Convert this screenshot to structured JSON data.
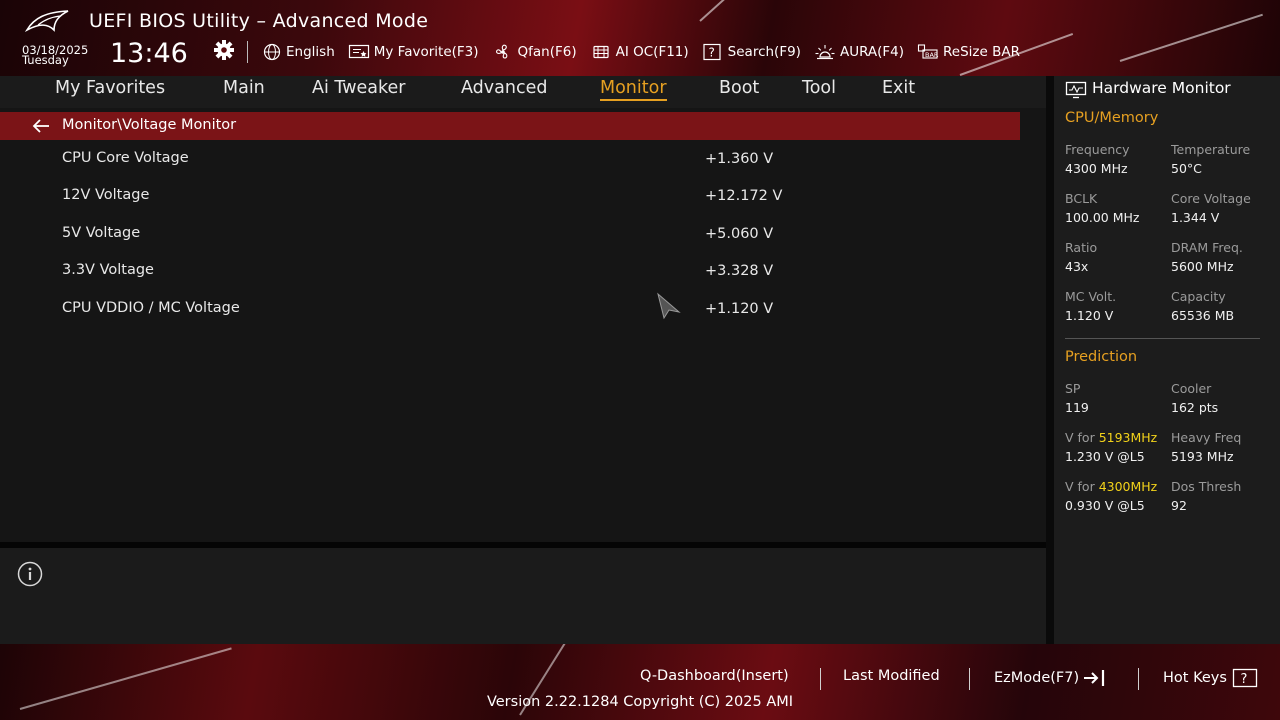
{
  "header": {
    "title": "UEFI BIOS Utility – Advanced Mode",
    "date": "03/18/2025",
    "day": "Tuesday",
    "time": "13:46"
  },
  "toolbar": {
    "items": [
      {
        "label": "English",
        "icon": "globe-icon"
      },
      {
        "label": "My Favorite(F3)",
        "icon": "favorite-monitor-icon"
      },
      {
        "label": "Qfan(F6)",
        "icon": "fan-icon"
      },
      {
        "label": "AI OC(F11)",
        "icon": "ai-chip-icon"
      },
      {
        "label": "Search(F9)",
        "icon": "search-help-icon"
      },
      {
        "label": "AURA(F4)",
        "icon": "aura-light-icon"
      },
      {
        "label": "ReSize BAR",
        "icon": "resize-bar-icon"
      }
    ]
  },
  "tabs": [
    {
      "label": "My Favorites"
    },
    {
      "label": "Main"
    },
    {
      "label": "Ai Tweaker"
    },
    {
      "label": "Advanced"
    },
    {
      "label": "Monitor",
      "active": true
    },
    {
      "label": "Boot"
    },
    {
      "label": "Tool"
    },
    {
      "label": "Exit"
    }
  ],
  "breadcrumb": "Monitor\\Voltage Monitor",
  "voltages": [
    {
      "label": "CPU Core Voltage",
      "value": "+1.360 V"
    },
    {
      "label": "12V Voltage",
      "value": "+12.172 V"
    },
    {
      "label": "5V Voltage",
      "value": "+5.060 V"
    },
    {
      "label": "3.3V Voltage",
      "value": "+3.328 V"
    },
    {
      "label": "CPU VDDIO / MC Voltage",
      "value": "+1.120 V"
    }
  ],
  "hardware_monitor": {
    "title": "Hardware Monitor",
    "cpu_memory": {
      "heading": "CPU/Memory",
      "frequency_label": "Frequency",
      "frequency": "4300 MHz",
      "temperature_label": "Temperature",
      "temperature": "50°C",
      "bclk_label": "BCLK",
      "bclk": "100.00 MHz",
      "core_voltage_label": "Core Voltage",
      "core_voltage": "1.344 V",
      "ratio_label": "Ratio",
      "ratio": "43x",
      "dram_freq_label": "DRAM Freq.",
      "dram_freq": "5600 MHz",
      "mc_volt_label": "MC Volt.",
      "mc_volt": "1.120 V",
      "capacity_label": "Capacity",
      "capacity": "65536 MB"
    },
    "prediction": {
      "heading": "Prediction",
      "sp_label": "SP",
      "sp": "119",
      "cooler_label": "Cooler",
      "cooler": "162 pts",
      "v_for_prefix": "V for ",
      "v_for_1_freq": "5193MHz",
      "v_for_1_value": "1.230 V @L5",
      "heavy_freq_label": "Heavy Freq",
      "heavy_freq": "5193 MHz",
      "v_for_2_freq": "4300MHz",
      "v_for_2_value": "0.930 V @L5",
      "dos_thresh_label": "Dos Thresh",
      "dos_thresh": "92"
    }
  },
  "footer": {
    "q_dashboard": "Q-Dashboard(Insert)",
    "last_modified": "Last Modified",
    "ezmode": "EzMode(F7)",
    "hot_keys": "Hot Keys",
    "version": "Version 2.22.1284 Copyright (C) 2025 AMI"
  },
  "colors": {
    "accent": "#e6a021",
    "highlight": "#f2d21a",
    "breadcrumb_bar": "#7b1417"
  }
}
